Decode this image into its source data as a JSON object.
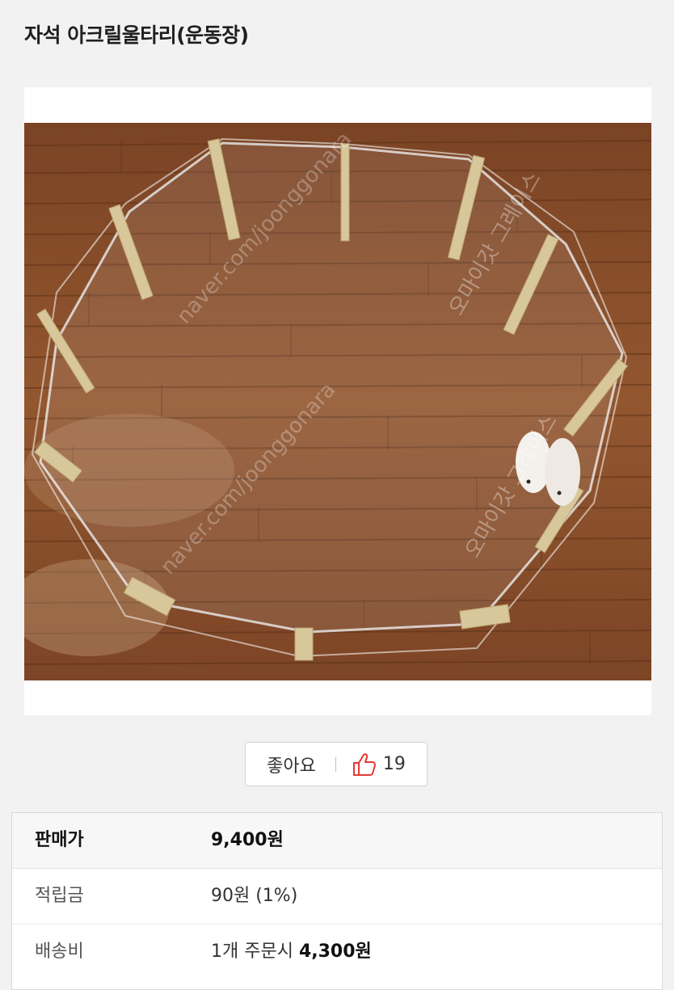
{
  "title": "자석 아크릴울타리(운동장)",
  "photo": {
    "alt": "아크릴 울타리와 햄스터 사진",
    "watermarks": [
      "naver.com/joonggonara",
      "오마이갓 그레이스"
    ]
  },
  "like": {
    "label": "좋아요",
    "count": "19",
    "icon": "thumbs-up-icon"
  },
  "details": {
    "price_label": "판매가",
    "price_value": "9,400원",
    "points_label": "적립금",
    "points_value": "90원 (1%)",
    "shipping_label": "배송비",
    "shipping_prefix": "1개 주문시 ",
    "shipping_value": "4,300원"
  },
  "colors": {
    "accent": "#e53935",
    "wood": "#8a4f2a"
  }
}
